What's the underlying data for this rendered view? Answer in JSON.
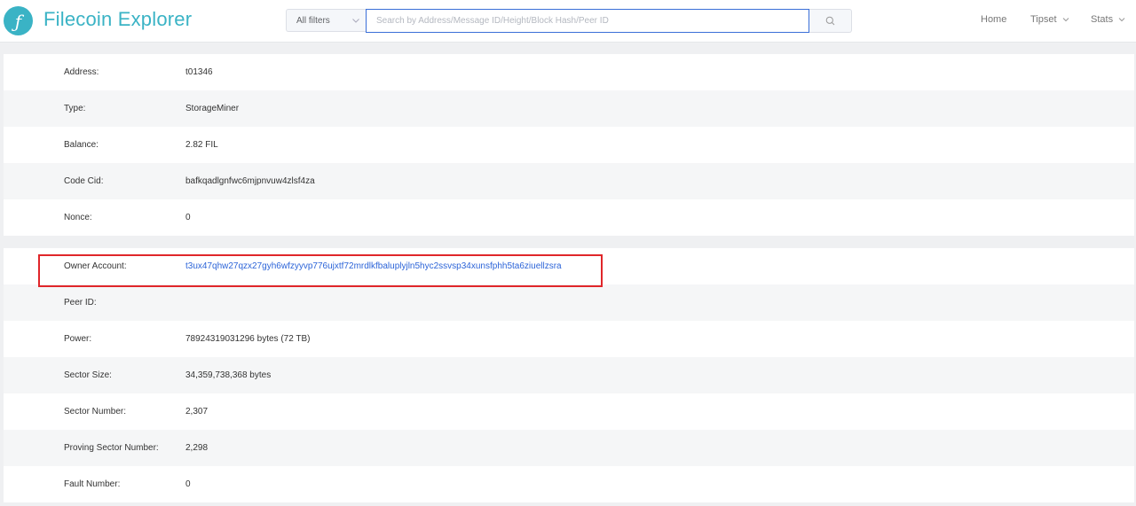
{
  "header": {
    "logo_glyph": "ƒ",
    "title": "Filecoin Explorer",
    "filter_label": "All filters",
    "search_placeholder": "Search by Address/Message ID/Height/Block Hash/Peer ID",
    "nav": {
      "home": "Home",
      "tipset": "Tipset",
      "stats": "Stats"
    },
    "brand_color": "#3ab3c5"
  },
  "account": {
    "rows": [
      {
        "label": "Address:",
        "value": "t01346"
      },
      {
        "label": "Type:",
        "value": "StorageMiner"
      },
      {
        "label": "Balance:",
        "value": "2.82 FIL"
      },
      {
        "label": "Code Cid:",
        "value": "bafkqadlgnfwc6mjpnvuw4zlsf4za"
      },
      {
        "label": "Nonce:",
        "value": "0"
      }
    ]
  },
  "miner": {
    "rows": [
      {
        "label": "Owner Account:",
        "value": "t3ux47qhw27qzx27gyh6wfzyyvp776ujxtf72mrdlkfbaluplyjln5hyc2ssvsp34xunsfphh5ta6ziuellzsra"
      },
      {
        "label": "Peer ID:",
        "value": ""
      },
      {
        "label": "Power:",
        "value": "78924319031296 bytes (72 TB)"
      },
      {
        "label": "Sector Size:",
        "value": "34,359,738,368 bytes"
      },
      {
        "label": "Sector Number:",
        "value": "2,307"
      },
      {
        "label": "Proving Sector Number:",
        "value": "2,298"
      },
      {
        "label": "Fault Number:",
        "value": "0"
      }
    ]
  },
  "colors": {
    "link": "#2c64d8",
    "highlight": "#e0262a"
  }
}
